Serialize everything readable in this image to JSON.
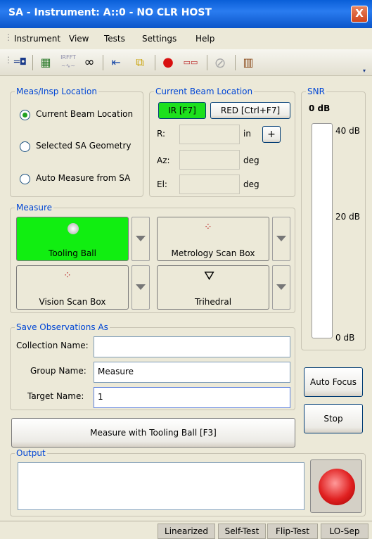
{
  "window": {
    "title": "SA - Instrument: A::0 - NO CLR HOST",
    "close_label": "X"
  },
  "menu": [
    "Instrument",
    "View",
    "Tests",
    "Settings",
    "Help"
  ],
  "toolbar": {
    "irfft_label": "IRFFT"
  },
  "meas_location": {
    "label": "Meas/Insp Location",
    "options": [
      "Current Beam Location",
      "Selected SA Geometry",
      "Auto Measure from SA"
    ],
    "selected": 0
  },
  "beam_location": {
    "label": "Current Beam Location",
    "ir_button": "IR [F7]",
    "red_button": "RED [Ctrl+F7]",
    "r_label": "R:",
    "r_unit": "in",
    "plus_label": "+",
    "az_label": "Az:",
    "az_unit": "deg",
    "el_label": "El:",
    "el_unit": "deg"
  },
  "snr": {
    "label": "SNR",
    "value": "0 dB",
    "ticks": [
      "40 dB",
      "20 dB",
      "0 dB"
    ]
  },
  "measure": {
    "label": "Measure",
    "tooling_ball": "Tooling Ball",
    "metrology_scan_box": "Metrology Scan Box",
    "vision_scan_box": "Vision Scan Box",
    "trihedral": "Trihedral"
  },
  "save_as": {
    "label": "Save Observations As",
    "collection_label": "Collection Name:",
    "collection_value": "",
    "group_label": "Group Name:",
    "group_value": "Measure",
    "target_label": "Target Name:",
    "target_value": "1"
  },
  "buttons": {
    "auto_focus": "Auto Focus",
    "stop": "Stop",
    "measure_with": "Measure with Tooling Ball [F3]"
  },
  "output": {
    "label": "Output"
  },
  "status": [
    "Linearized",
    "Self-Test",
    "Flip-Test",
    "LO-Sep"
  ]
}
